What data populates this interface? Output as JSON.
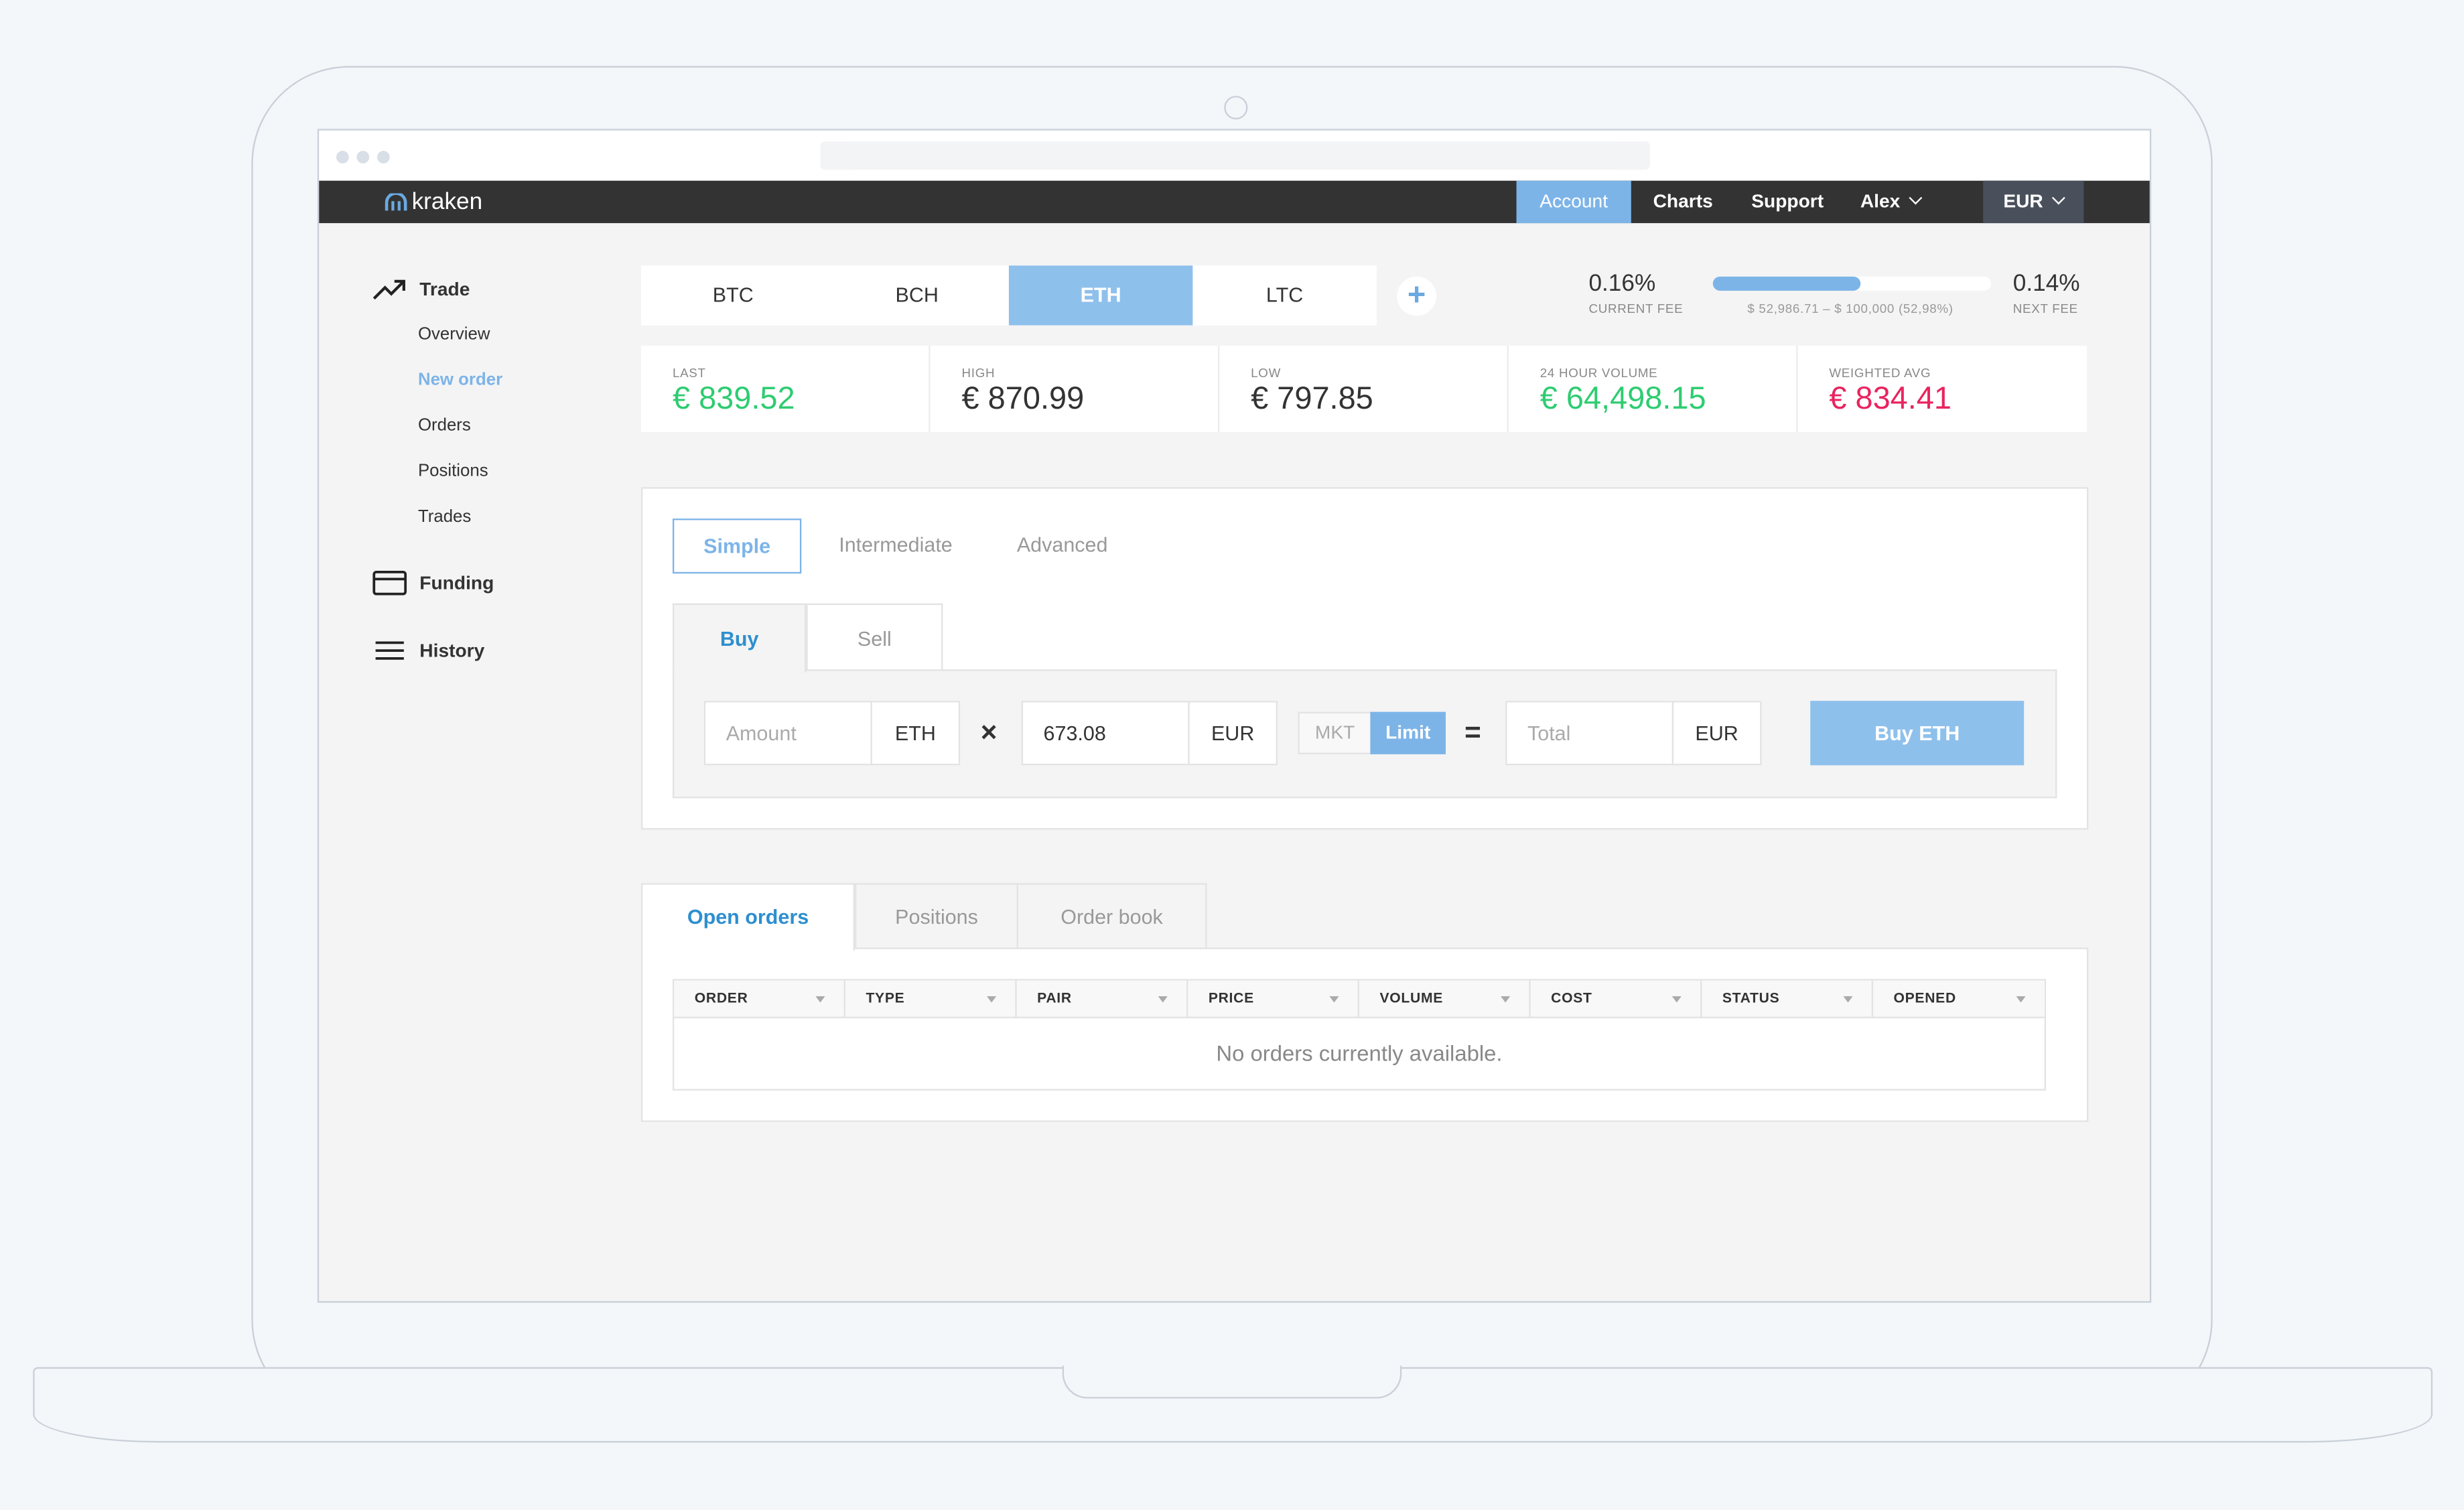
{
  "brand": {
    "name": "kraken"
  },
  "topnav": {
    "items": [
      {
        "label": "Account"
      },
      {
        "label": "Charts"
      },
      {
        "label": "Support"
      },
      {
        "label": "Alex"
      },
      {
        "label": "EUR"
      }
    ]
  },
  "sidebar": {
    "trade": {
      "label": "Trade",
      "icon": "trending-up-icon"
    },
    "trade_items": [
      {
        "label": "Overview"
      },
      {
        "label": "New order",
        "active": true
      },
      {
        "label": "Orders"
      },
      {
        "label": "Positions"
      },
      {
        "label": "Trades"
      }
    ],
    "funding": {
      "label": "Funding",
      "icon": "card-icon"
    },
    "history": {
      "label": "History",
      "icon": "menu-lines-icon"
    }
  },
  "coins": {
    "tabs": [
      {
        "label": "BTC"
      },
      {
        "label": "BCH"
      },
      {
        "label": "ETH",
        "active": true
      },
      {
        "label": "LTC"
      }
    ],
    "add_label": "+"
  },
  "fees": {
    "current": "0.16%",
    "current_label": "CURRENT FEE",
    "range": "$ 52,986.71 – $ 100,000 (52,98%)",
    "progress": 0.5298,
    "next": "0.14%",
    "next_label": "NEXT FEE"
  },
  "stats": [
    {
      "label": "LAST",
      "value": "€ 839.52",
      "color": "#2ecc71"
    },
    {
      "label": "HIGH",
      "value": "€ 870.99",
      "color": "#333333"
    },
    {
      "label": "LOW",
      "value": "€ 797.85",
      "color": "#333333"
    },
    {
      "label": "24 HOUR VOLUME",
      "value": "€ 64,498.15",
      "color": "#2ecc71"
    },
    {
      "label": "WEIGHTED AVG",
      "value": "€ 834.41",
      "color": "#e8245f"
    }
  ],
  "order": {
    "modes": [
      {
        "label": "Simple",
        "active": true
      },
      {
        "label": "Intermediate"
      },
      {
        "label": "Advanced"
      }
    ],
    "side_tabs": [
      {
        "label": "Buy",
        "active": true
      },
      {
        "label": "Sell"
      }
    ],
    "amount_placeholder": "Amount",
    "amount_unit": "ETH",
    "times": "×",
    "price_value": "673.08",
    "price_unit": "EUR",
    "type_mkt": "MKT",
    "type_limit": "Limit",
    "equals": "=",
    "total_placeholder": "Total",
    "total_unit": "EUR",
    "submit_label": "Buy ETH"
  },
  "orders": {
    "tabs": [
      {
        "label": "Open orders",
        "active": true
      },
      {
        "label": "Positions"
      },
      {
        "label": "Order book"
      }
    ],
    "columns": [
      "ORDER",
      "TYPE",
      "PAIR",
      "PRICE",
      "VOLUME",
      "COST",
      "STATUS",
      "OPENED"
    ],
    "empty_message": "No orders currently available."
  },
  "colors": {
    "accent": "#7db4e8",
    "nav_bg": "#333333",
    "positive": "#2ecc71",
    "negative": "#e8245f"
  }
}
